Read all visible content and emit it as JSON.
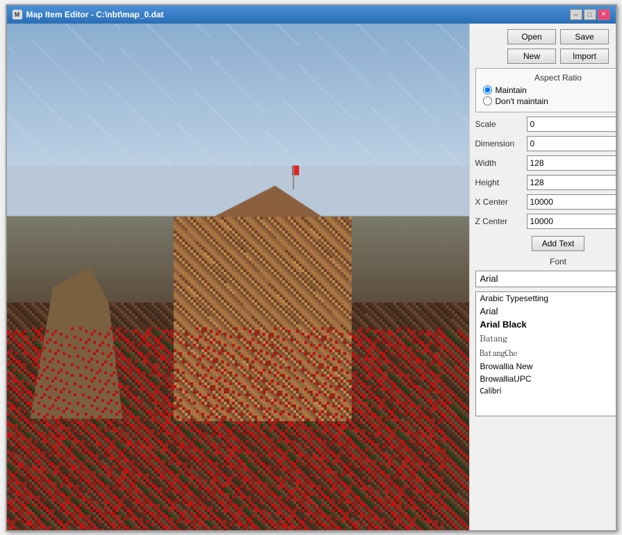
{
  "window": {
    "title": "Map Item Editor - C:\\nbt\\map_0.dat",
    "icon": "M"
  },
  "titlebar": {
    "controls": [
      "─",
      "□",
      "✕"
    ]
  },
  "buttons": {
    "open": "Open",
    "save": "Save",
    "new": "New",
    "import": "Import",
    "add_text": "Add Text"
  },
  "aspect_ratio": {
    "title": "Aspect Ratio",
    "maintain": "Maintain",
    "dont_maintain": "Don't maintain"
  },
  "fields": {
    "scale": {
      "label": "Scale",
      "value": "0"
    },
    "dimension": {
      "label": "Dimension",
      "value": "0"
    },
    "width": {
      "label": "Width",
      "value": "128"
    },
    "height": {
      "label": "Height",
      "value": "128"
    },
    "x_center": {
      "label": "X Center",
      "value": "10000"
    },
    "z_center": {
      "label": "Z Center",
      "value": "10000"
    }
  },
  "font": {
    "label": "Font",
    "selected": "Arial",
    "list": [
      {
        "name": "Arabic Typesetting",
        "style": "normal"
      },
      {
        "name": "Arial",
        "style": "arial"
      },
      {
        "name": "Arial Black",
        "style": "bold"
      },
      {
        "name": "Batang",
        "style": "batang"
      },
      {
        "name": "BatangChe",
        "style": "batangche"
      },
      {
        "name": "Browallia New",
        "style": "browallia"
      },
      {
        "name": "BrowalliaUPC",
        "style": "browalliaUPC"
      },
      {
        "name": "Calibri",
        "style": "calibri"
      }
    ]
  }
}
